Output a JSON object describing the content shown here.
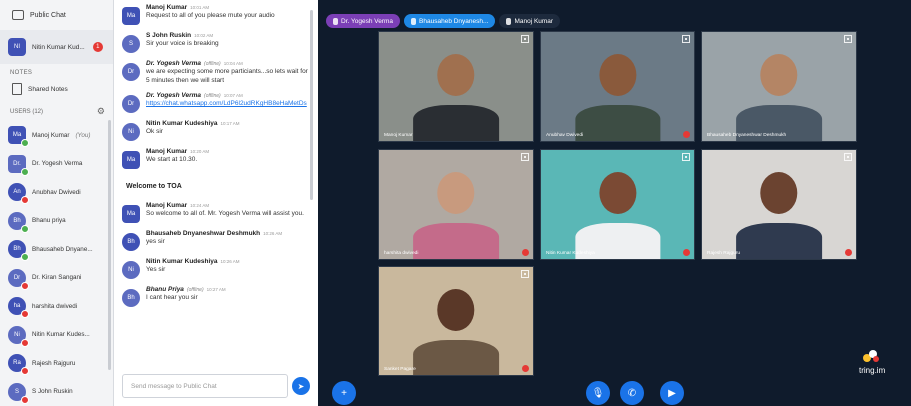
{
  "sidebar": {
    "public_chat": "Public Chat",
    "pinned_user": {
      "initials": "NI",
      "name": "Nitin Kumar Kud...",
      "badge": "1"
    },
    "notes_heading": "NOTES",
    "shared_notes": "Shared Notes",
    "users_heading": "USERS (12)",
    "users": [
      {
        "initials": "Ma",
        "name": "Manoj Kumar",
        "suffix": "(You)",
        "color": "#3f51b5",
        "mic": "#4caf50",
        "shape": "square"
      },
      {
        "initials": "Dr.",
        "name": "Dr. Yogesh Verma",
        "suffix": "",
        "color": "#5c6bc0",
        "mic": "#4caf50",
        "shape": "square"
      },
      {
        "initials": "An",
        "name": "Anubhav Dwivedi",
        "suffix": "",
        "color": "#3f51b5",
        "mic": "#e53935",
        "shape": "round"
      },
      {
        "initials": "Bh",
        "name": "Bhanu priya",
        "suffix": "",
        "color": "#5c6bc0",
        "mic": "#4caf50",
        "shape": "round"
      },
      {
        "initials": "Bh",
        "name": "Bhausaheb Dnyane...",
        "suffix": "",
        "color": "#3f51b5",
        "mic": "#4caf50",
        "shape": "round"
      },
      {
        "initials": "Dr",
        "name": "Dr. Kiran Sangani",
        "suffix": "",
        "color": "#5c6bc0",
        "mic": "#e53935",
        "shape": "round"
      },
      {
        "initials": "ha",
        "name": "harshita dwivedi",
        "suffix": "",
        "color": "#3f51b5",
        "mic": "#e53935",
        "shape": "round"
      },
      {
        "initials": "Ni",
        "name": "Nitin Kumar Kudes...",
        "suffix": "",
        "color": "#5c6bc0",
        "mic": "#e53935",
        "shape": "round"
      },
      {
        "initials": "Ra",
        "name": "Rajesh Rajguru",
        "suffix": "",
        "color": "#3f51b5",
        "mic": "#e53935",
        "shape": "round"
      },
      {
        "initials": "S",
        "name": "S John Ruskin",
        "suffix": "",
        "color": "#5c6bc0",
        "mic": "#e53935",
        "shape": "round"
      }
    ]
  },
  "chat": {
    "messages": [
      {
        "initials": "Ma",
        "name": "Manoj Kumar",
        "time": "10:01 AM",
        "offline": "",
        "italic": false,
        "color": "#3f51b5",
        "shape": "square",
        "lines": [
          "Request to all of you please mute your audio"
        ]
      },
      {
        "initials": "S",
        "name": "S John Ruskin",
        "time": "10:02 AM",
        "offline": "",
        "italic": false,
        "color": "#5c6bc0",
        "shape": "round",
        "lines": [
          "Sir your voice is breaking"
        ]
      },
      {
        "initials": "Dr",
        "name": "Dr. Yogesh Verma",
        "time": "10:04 AM",
        "offline": "(offline)",
        "italic": true,
        "color": "#5c6bc0",
        "shape": "round",
        "lines": [
          "we are expecting some more particiants...so lets wait for 5 minutes then we will start"
        ]
      },
      {
        "initials": "Dr",
        "name": "Dr. Yogesh Verma",
        "time": "10:07 AM",
        "offline": "(offline)",
        "italic": true,
        "color": "#5c6bc0",
        "shape": "round",
        "link": "https://chat.whatsapp.com/LdP6l2udRKgHB8eHaMetDs",
        "lines": []
      },
      {
        "initials": "Ni",
        "name": "Nitin Kumar Kudeshiya",
        "time": "10:17 AM",
        "offline": "",
        "italic": false,
        "color": "#5c6bc0",
        "shape": "round",
        "lines": [
          "Ok sir"
        ]
      },
      {
        "initials": "Ma",
        "name": "Manoj Kumar",
        "time": "10:20 AM",
        "offline": "",
        "italic": false,
        "color": "#3f51b5",
        "shape": "square",
        "lines": [
          "We start at 10.30."
        ]
      }
    ],
    "welcome": "Welcome to TOA",
    "messages2": [
      {
        "initials": "Ma",
        "name": "Manoj Kumar",
        "time": "10:24 AM",
        "offline": "",
        "italic": false,
        "color": "#3f51b5",
        "shape": "square",
        "lines": [
          "So welcome to all of. Mr. Yogesh Verma will assist you."
        ]
      },
      {
        "initials": "Bh",
        "name": "Bhausaheb Dnyaneshwar Deshmukh",
        "time": "10:26 AM",
        "offline": "",
        "italic": false,
        "color": "#3f51b5",
        "shape": "round",
        "lines": [
          "yes sir"
        ]
      },
      {
        "initials": "Ni",
        "name": "Nitin Kumar Kudeshiya",
        "time": "10:26 AM",
        "offline": "",
        "italic": false,
        "color": "#5c6bc0",
        "shape": "round",
        "lines": [
          "Yes sir"
        ]
      },
      {
        "initials": "Bh",
        "name": "Bhanu Priya",
        "time": "10:27 AM",
        "offline": "(offline)",
        "italic": true,
        "color": "#5c6bc0",
        "shape": "round",
        "lines": [
          "I cant hear you sir"
        ]
      }
    ],
    "input_placeholder": "Send message to Public Chat"
  },
  "video": {
    "pills": [
      {
        "label": "Dr. Yogesh Verma",
        "color": "#7b3fb6"
      },
      {
        "label": "Bhausaheb Dnyanesh...",
        "color": "#1e88e5"
      },
      {
        "label": "Manoj Kumar",
        "color": "#1d2a3d"
      }
    ],
    "tiles": [
      {
        "name": "Manoj Kumar",
        "bg": "#8a8f8a",
        "skin": "#a0704f",
        "shirt": "#2a2e33",
        "muted": false
      },
      {
        "name": "Anubhav Dwivedi",
        "bg": "#6b7a86",
        "skin": "#8a5a3c",
        "shirt": "#3d4d44",
        "muted": true
      },
      {
        "name": "Bhausaheb Dnyaneshwar Deshmukh",
        "bg": "#9aa3a8",
        "skin": "#b48565",
        "shirt": "#4a5866",
        "muted": false
      },
      {
        "name": "harshita dwivedi",
        "bg": "#b0a9a2",
        "skin": "#c89a7e",
        "shirt": "#c46b8a",
        "muted": true
      },
      {
        "name": "Nitin Kumar Kudeshiya",
        "bg": "#5ab7b6",
        "skin": "#7b4a34",
        "shirt": "#eef0f2",
        "muted": true
      },
      {
        "name": "Rajesh Rajguru",
        "bg": "#d8d6d3",
        "skin": "#6b4330",
        "shirt": "#2f3a4f",
        "muted": true
      },
      {
        "name": "Sanket Pagare",
        "bg": "#c9b89d",
        "skin": "#5a3828",
        "shirt": "#6b5845",
        "muted": true
      }
    ],
    "brand": "tring.im"
  }
}
